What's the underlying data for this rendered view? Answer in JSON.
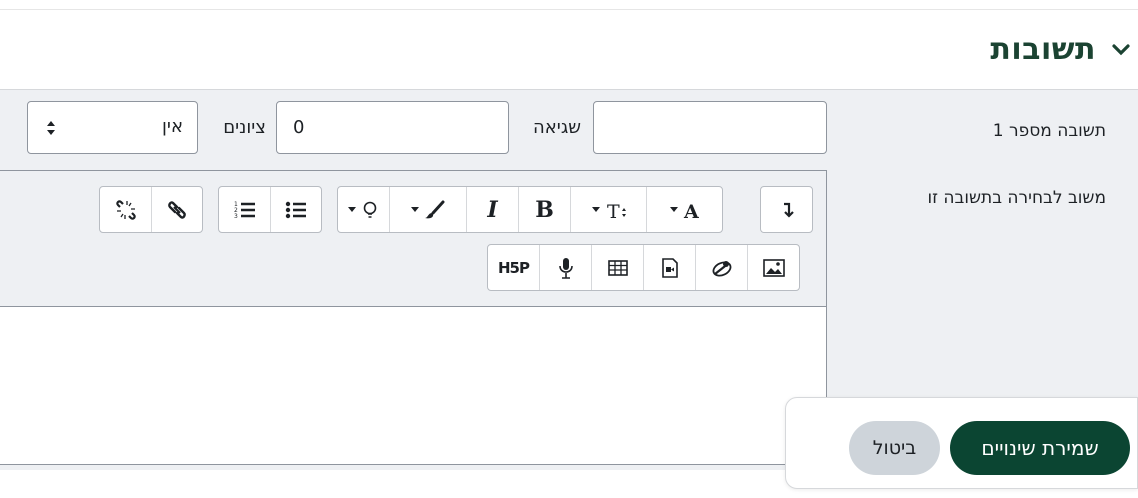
{
  "section": {
    "title": "תשובות",
    "collapse_icon": "chevron-down-icon"
  },
  "answer": {
    "label": "תשובה מספר 1",
    "value": "",
    "error_label": "שגיאה",
    "error_value": "0",
    "grade_label": "ציונים",
    "grade_selected": "אין"
  },
  "feedback": {
    "label": "משוב לבחירה בתשובה זו"
  },
  "toolbar": {
    "row1": [
      "paragraph-direction-icon",
      "font-color-icon",
      "font-size-icon",
      "bold-icon",
      "italic-icon",
      "brush-icon",
      "lightbulb-icon",
      "unordered-list-icon",
      "ordered-list-icon",
      "link-icon",
      "unlink-icon"
    ],
    "row2": [
      "image-icon",
      "media-icon",
      "video-file-icon",
      "table-icon",
      "microphone-icon",
      "h5p-icon"
    ],
    "bold": "B",
    "italic": "I",
    "color_a": "A",
    "size_t": "T",
    "h5p": "H5P"
  },
  "buttons": {
    "save": "שמירת שינויים",
    "cancel": "ביטול"
  },
  "colors": {
    "brand": "#0b4532",
    "title": "#1b4332"
  }
}
